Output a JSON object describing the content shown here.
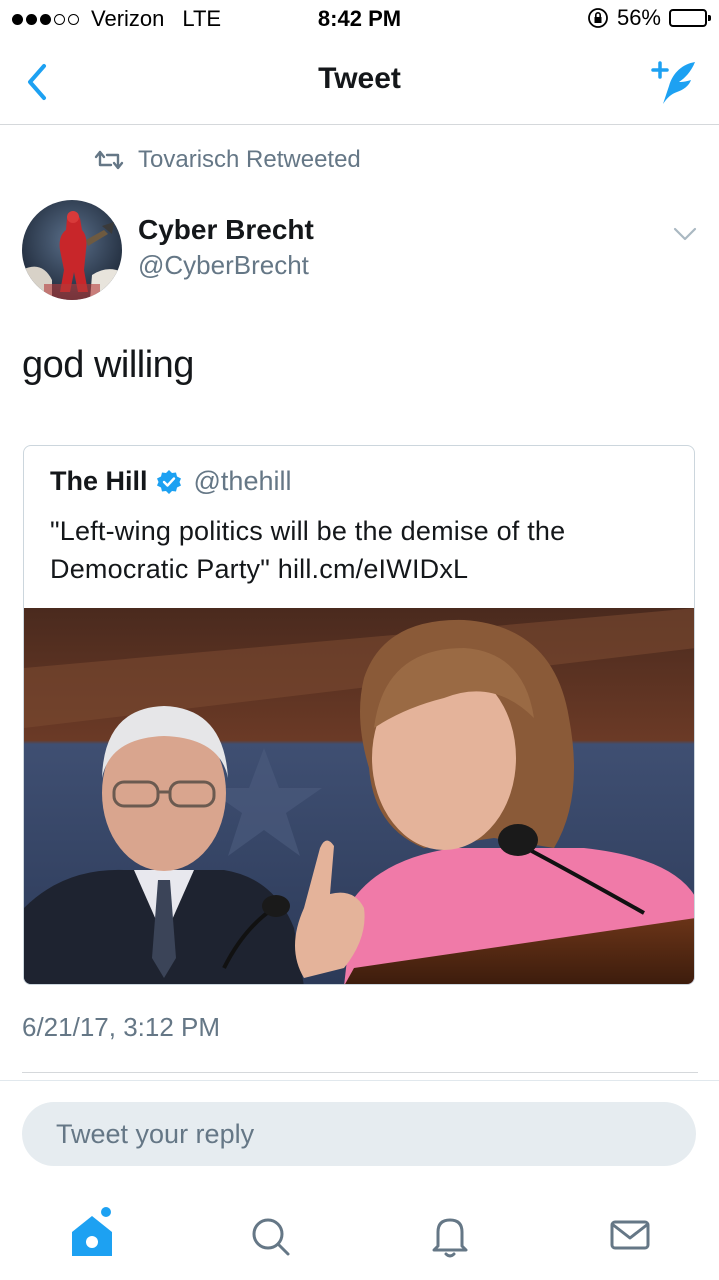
{
  "status_bar": {
    "carrier": "Verizon",
    "network": "LTE",
    "time": "8:42 PM",
    "battery": "56%",
    "battery_level": 0.56,
    "signal_bars_filled": 3,
    "signal_bars_total": 5
  },
  "nav": {
    "title": "Tweet",
    "back_icon": "chevron-left-icon",
    "compose_icon": "compose-tweet-icon"
  },
  "retweet_context": {
    "text": "Tovarisch Retweeted",
    "icon": "retweet-icon"
  },
  "tweet": {
    "author_name": "Cyber Brecht",
    "author_handle": "@CyberBrecht",
    "text": "god willing",
    "timestamp": "6/21/17, 3:12 PM"
  },
  "quoted_tweet": {
    "author_name": "The Hill",
    "author_handle": "@thehill",
    "verified": true,
    "text": "\"Left-wing politics will be the demise of the Democratic Party\" hill.cm/eIWIDxL"
  },
  "reply": {
    "placeholder": "Tweet your reply"
  },
  "tab_bar": {
    "tabs": [
      "home-icon",
      "search-icon",
      "notifications-icon",
      "messages-icon"
    ],
    "accent": "#1da1f2"
  },
  "colors": {
    "accent": "#1da1f2",
    "secondary_text": "#657786",
    "battery_fill": "#f5c518"
  }
}
